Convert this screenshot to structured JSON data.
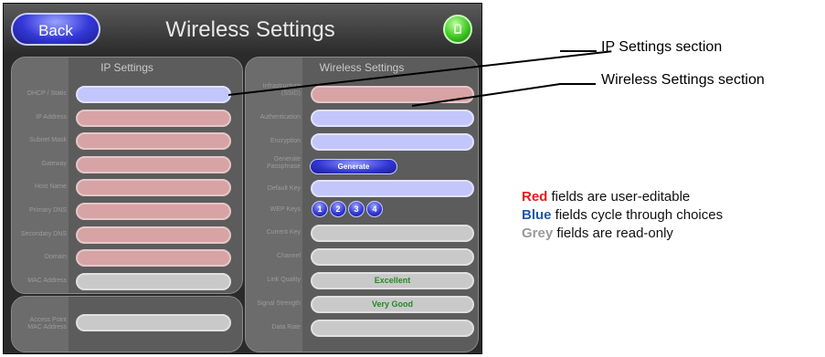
{
  "screen": {
    "back_label": "Back",
    "title": "Wireless Settings",
    "green_button_icon": "lock-icon",
    "ip_panel": {
      "title": "IP Settings",
      "fields": [
        {
          "label": "DHCP / Static",
          "color": "blue",
          "value": ""
        },
        {
          "label": "IP Address",
          "color": "red",
          "value": ""
        },
        {
          "label": "Subnet Mask",
          "color": "red",
          "value": ""
        },
        {
          "label": "Gateway",
          "color": "red",
          "value": ""
        },
        {
          "label": "Host Name",
          "color": "red",
          "value": ""
        },
        {
          "label": "Primary DNS",
          "color": "red",
          "value": ""
        },
        {
          "label": "Secondary DNS",
          "color": "red",
          "value": ""
        },
        {
          "label": "Domain",
          "color": "red",
          "value": ""
        },
        {
          "label": "MAC Address",
          "color": "grey",
          "value": ""
        }
      ]
    },
    "ap_panel": {
      "label": "Access Point MAC Address",
      "value": ""
    },
    "wireless_panel": {
      "title": "Wireless Settings",
      "ssid_label": "Infrastructure (SSID)",
      "authentication_label": "Authentication",
      "encryption_label": "Encryption",
      "generate_label": "Generate Passphrase",
      "generate_button": "Generate",
      "default_key_label": "Default Key",
      "wep_keys_label": "WEP Keys",
      "wep_keys": [
        "1",
        "2",
        "3",
        "4"
      ],
      "current_key_label": "Current Key",
      "channel_label": "Channel",
      "link_quality_label": "Link Quality",
      "link_quality_value": "Excellent",
      "signal_strength_label": "Signal Strength",
      "signal_strength_value": "Very Good",
      "data_rate_label": "Data Rate"
    }
  },
  "callouts": {
    "ip": "IP Settings section",
    "wireless": "Wireless Settings section"
  },
  "legend": {
    "red_word": "Red",
    "red_text": " fields are user-editable",
    "blue_word": "Blue",
    "blue_text": " fields cycle through choices",
    "grey_word": "Grey",
    "grey_text": " fields are read-only",
    "red_color": "#e8191c",
    "blue_color": "#1d5aa8",
    "grey_color": "#9a9a9a"
  }
}
